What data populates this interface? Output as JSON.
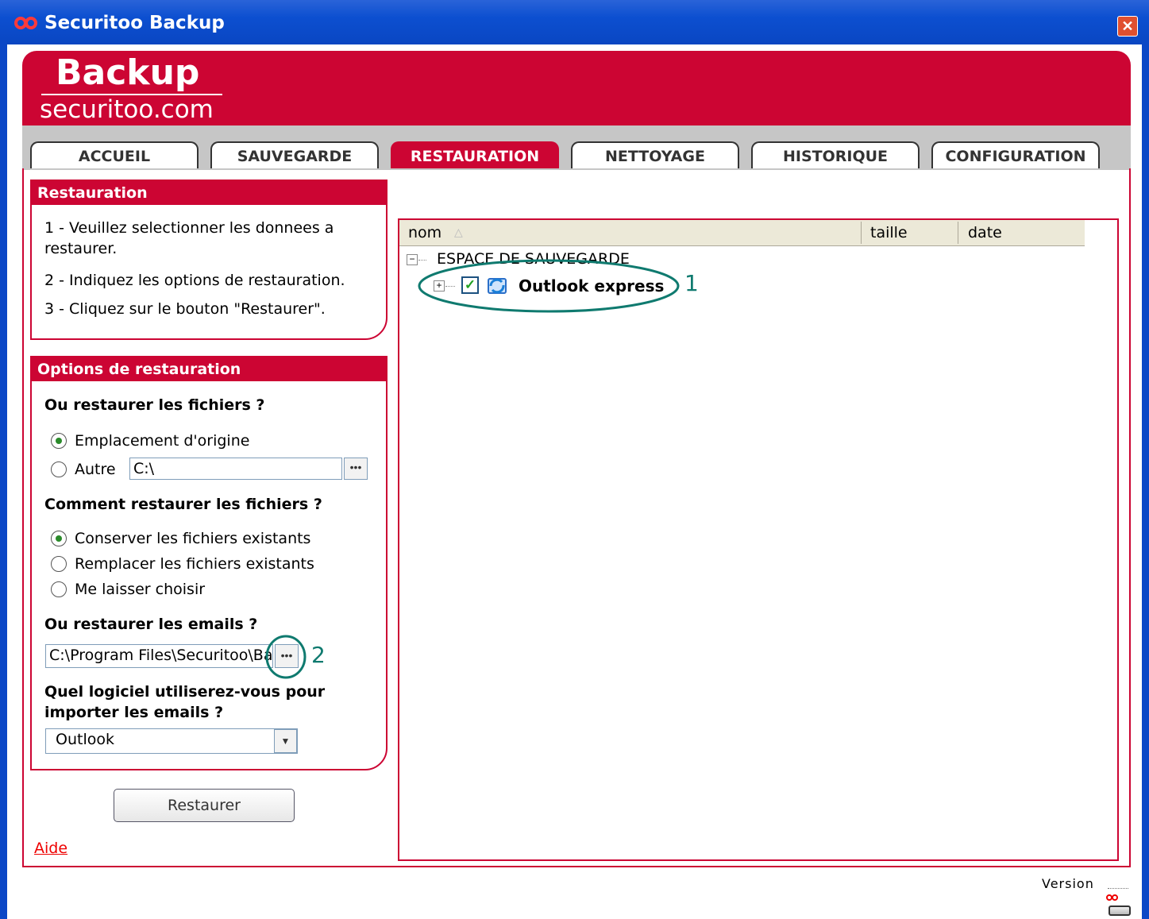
{
  "window": {
    "title": "Securitoo Backup"
  },
  "brand": {
    "logo_title": "Backup",
    "logo_sub": "securitoo.com"
  },
  "tabs": [
    "ACCUEIL",
    "SAUVEGARDE",
    "RESTAURATION",
    "NETTOYAGE",
    "HISTORIQUE",
    "CONFIGURATION"
  ],
  "active_tab": "RESTAURATION",
  "help_panel": {
    "title": "Restauration",
    "steps": [
      "1 - Veuillez selectionner les donnees a",
      "restaurer.",
      "2 - Indiquez les options de restauration.",
      "3 - Cliquez sur le bouton \"Restaurer\"."
    ]
  },
  "options_panel": {
    "title": "Options de restauration",
    "where_files_q": "Ou restaurer les fichiers ?",
    "opt_origin": "Emplacement d'origine",
    "opt_other": "Autre",
    "other_path": "C:\\",
    "how_files_q": "Comment restaurer les fichiers ?",
    "opt_keep": "Conserver les fichiers existants",
    "opt_replace": "Remplacer les fichiers existants",
    "opt_choose": "Me laisser choisir",
    "where_emails_q": "Ou restaurer les emails ?",
    "email_path": "C:\\Program Files\\Securitoo\\Bac",
    "which_soft_q1": "Quel logiciel utiliserez-vous pour",
    "which_soft_q2": "importer les emails ?",
    "software": "Outlook",
    "annotation_2": "2"
  },
  "restore_button": "Restaurer",
  "help_link": "Aide",
  "tree": {
    "columns": [
      "nom",
      "taille",
      "date"
    ],
    "root": "ESPACE DE SAUVEGARDE",
    "child": "Outlook express",
    "annotation_1": "1"
  },
  "footer": {
    "version_label": "Version"
  },
  "colors": {
    "brand_red": "#cc0533",
    "title_blue": "#0b47c6",
    "annotation": "#0f7a6f"
  }
}
